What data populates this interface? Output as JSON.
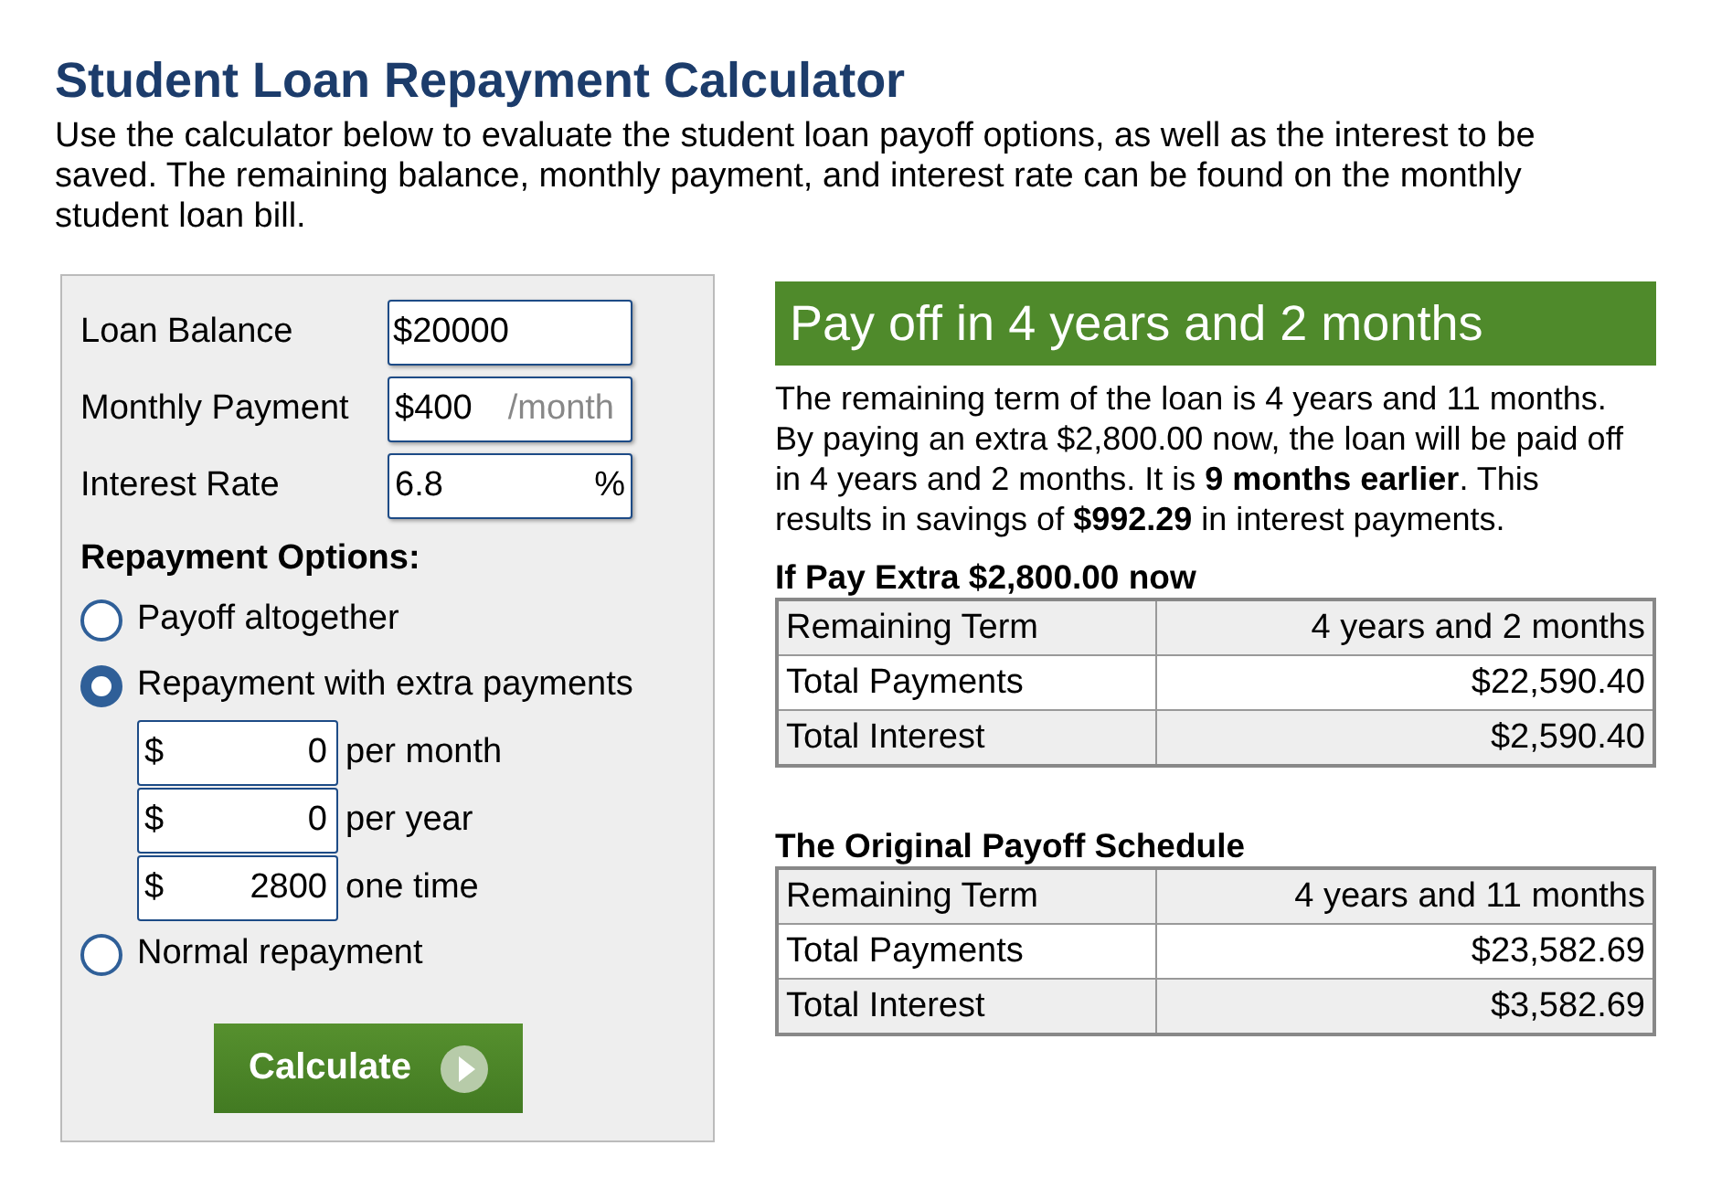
{
  "title": "Student Loan Repayment Calculator",
  "intro": "Use the calculator below to evaluate the student loan payoff options, as well as the interest to be saved. The remaining balance, monthly payment, and interest rate can be found on the monthly student loan bill.",
  "inputs": [
    {
      "label": "Loan Balance",
      "value": "$20000",
      "kind": "plain"
    },
    {
      "label": "Monthly Payment",
      "value": "$400",
      "unit": "/month",
      "kind": "hint"
    },
    {
      "label": "Interest Rate",
      "value": "6.8",
      "unit": "%",
      "kind": "symbol"
    }
  ],
  "repayment_options": {
    "heading": "Repayment Options:",
    "options": [
      {
        "label": "Payoff altogether",
        "selected": false
      },
      {
        "label": "Repayment with extra payments",
        "selected": true,
        "extras": [
          {
            "prefix": "$",
            "value": "0",
            "label": "per month"
          },
          {
            "prefix": "$",
            "value": "0",
            "label": "per year"
          },
          {
            "prefix": "$",
            "value": "2800",
            "label": "one time"
          }
        ]
      },
      {
        "label": "Normal repayment",
        "selected": false
      }
    ]
  },
  "calculate_button": "Calculate",
  "result": {
    "headline": "Pay off in 4 years and 2 months",
    "summary": "The remaining term of the loan is 4 years and 11 months. By paying an extra $2,800.00 now, the loan will be paid off in 4 years and 2 months. It is **9 months earlier**. This results in savings of **$992.29** in interest payments.",
    "tables": [
      {
        "title": "If Pay Extra $2,800.00 now",
        "rows": [
          {
            "label": "Remaining Term",
            "value": "4 years and 2 months"
          },
          {
            "label": "Total Payments",
            "value": "$22,590.40"
          },
          {
            "label": "Total Interest",
            "value": "$2,590.40"
          }
        ]
      },
      {
        "title": "The Original Payoff Schedule",
        "rows": [
          {
            "label": "Remaining Term",
            "value": "4 years and 11 months"
          },
          {
            "label": "Total Payments",
            "value": "$23,582.69"
          },
          {
            "label": "Total Interest",
            "value": "$3,582.69"
          }
        ]
      }
    ]
  }
}
